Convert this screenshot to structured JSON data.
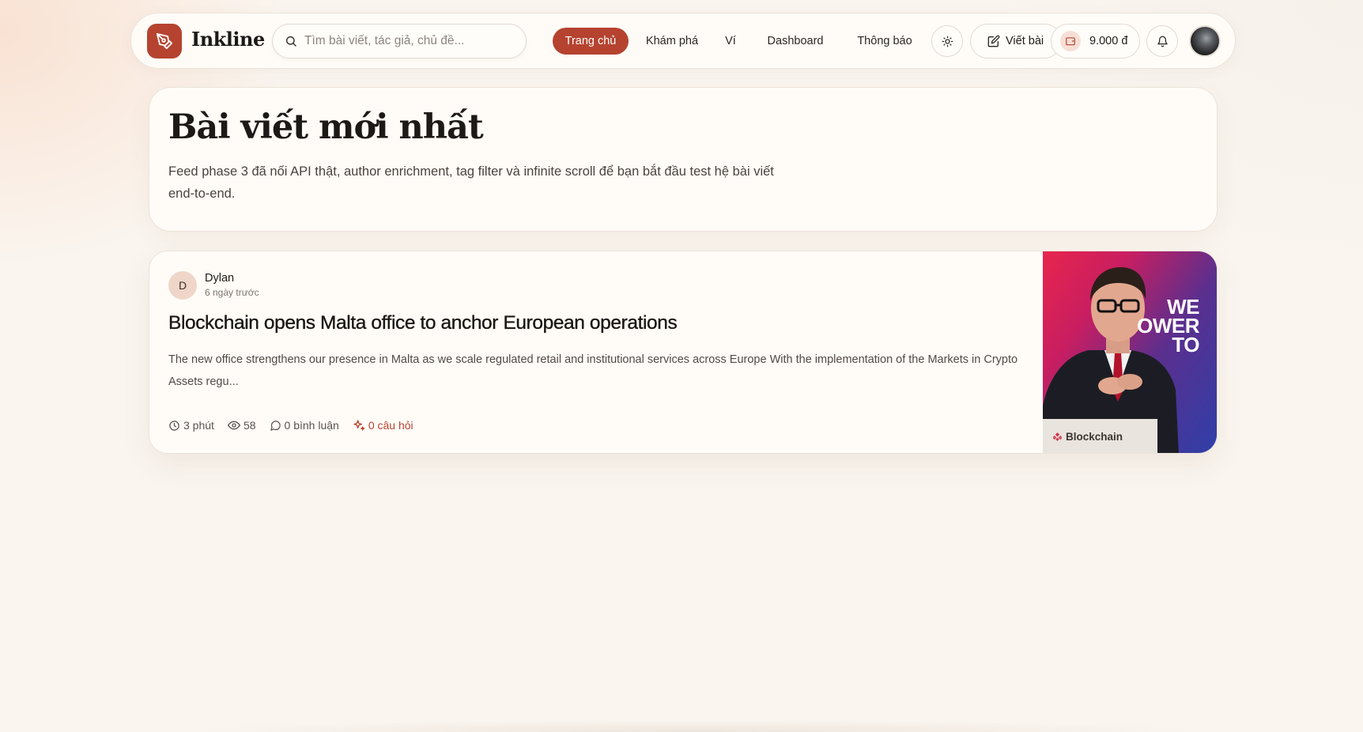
{
  "brand": {
    "name": "Inkline",
    "accent": "#b5432f"
  },
  "search": {
    "placeholder": "Tìm bài viết, tác giả, chủ đề..."
  },
  "nav": {
    "items": [
      {
        "label": "Trang chủ",
        "active": true
      },
      {
        "label": "Khám phá",
        "active": false
      },
      {
        "label": "Ví",
        "active": false
      },
      {
        "label": "Dashboard",
        "active": false
      },
      {
        "label": "Thông báo",
        "active": false
      }
    ],
    "theme_icon": "sun-icon",
    "write_label": "Viết bài",
    "write_icon": "edit-icon",
    "wallet_balance": "9.000 đ",
    "wallet_icon": "wallet-icon",
    "bell_icon": "bell-icon"
  },
  "hero": {
    "title": "Bài viết mới nhất",
    "description": "Feed phase 3 đã nối API thật, author enrichment, tag filter và infinite scroll để bạn bắt đầu test hệ bài viết end-to-end."
  },
  "articles": [
    {
      "author_initial": "D",
      "author_name": "Dylan",
      "time_ago": "6 ngày trước",
      "title": "Blockchain opens Malta office to anchor European operations",
      "excerpt": "The new office strengthens our presence in Malta as we scale regulated retail and institutional services across Europe With the implementation of the Markets in Crypto Assets regu...",
      "read_time": "3 phút",
      "views": "58",
      "comments": "0 bình luận",
      "questions": "0 câu hỏi",
      "thumbnail_text": [
        "WE",
        "OWER",
        "TO"
      ],
      "thumbnail_podium": "Blockchain"
    }
  ]
}
